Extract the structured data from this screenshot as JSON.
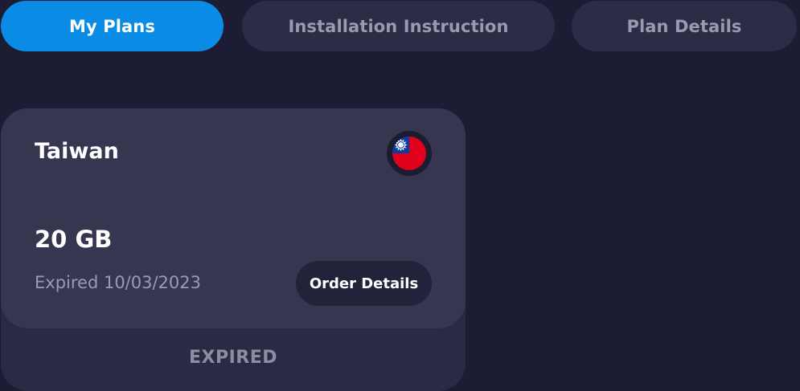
{
  "tabs": [
    {
      "label": "My Plans",
      "active": true
    },
    {
      "label": "Installation Instruction",
      "active": false
    },
    {
      "label": "Plan Details",
      "active": false
    }
  ],
  "plan": {
    "country": "Taiwan",
    "flag_icon": "taiwan-flag-icon",
    "data_amount": "20 GB",
    "expiry_text": "Expired 10/03/2023",
    "order_details_label": "Order Details",
    "status": "EXPIRED"
  },
  "colors": {
    "background": "#1c1c34",
    "tab_inactive": "#2c2c47",
    "tab_active": "#0a8ce6",
    "card": "#363650",
    "card_footer": "#2a2a44",
    "flag_red": "#e0001b",
    "flag_blue": "#0b3c9e"
  }
}
